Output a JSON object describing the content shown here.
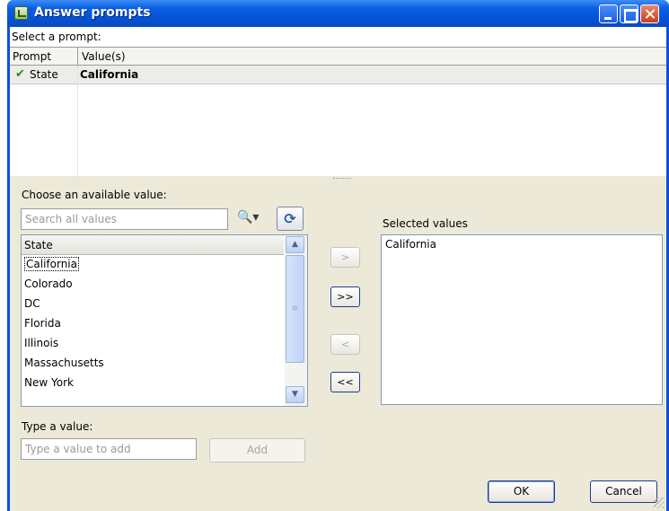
{
  "window": {
    "title": "Answer prompts",
    "icons": [
      "app-icon",
      "minimize-icon",
      "maximize-icon",
      "close-icon"
    ]
  },
  "prompts": {
    "label": "Select a prompt:",
    "columns": [
      "Prompt",
      "Value(s)"
    ],
    "rows": [
      {
        "status_icon": "check-icon",
        "check_glyph": "✔",
        "prompt": "State",
        "value": "California"
      }
    ]
  },
  "available": {
    "label": "Choose an available value:",
    "search_placeholder": "Search all values",
    "find_icon_glyph": "🔍▾",
    "refresh_glyph": "⟳",
    "header": "State",
    "items": [
      "California",
      "Colorado",
      "DC",
      "Florida",
      "Illinois",
      "Massachusetts",
      "New York"
    ],
    "focused_item": "California",
    "scroll_up_glyph": "▲",
    "scroll_down_glyph": "▼",
    "scroll_thumb_glyph": "≡"
  },
  "move_buttons": {
    "add_one": ">",
    "add_all": ">>",
    "remove_one": "<",
    "remove_all": "<<"
  },
  "selected": {
    "label": "Selected values",
    "items": [
      "California"
    ]
  },
  "type_value": {
    "label": "Type a value:",
    "placeholder": "Type a value to add",
    "add_label": "Add"
  },
  "footer": {
    "ok_label": "OK",
    "cancel_label": "Cancel"
  }
}
